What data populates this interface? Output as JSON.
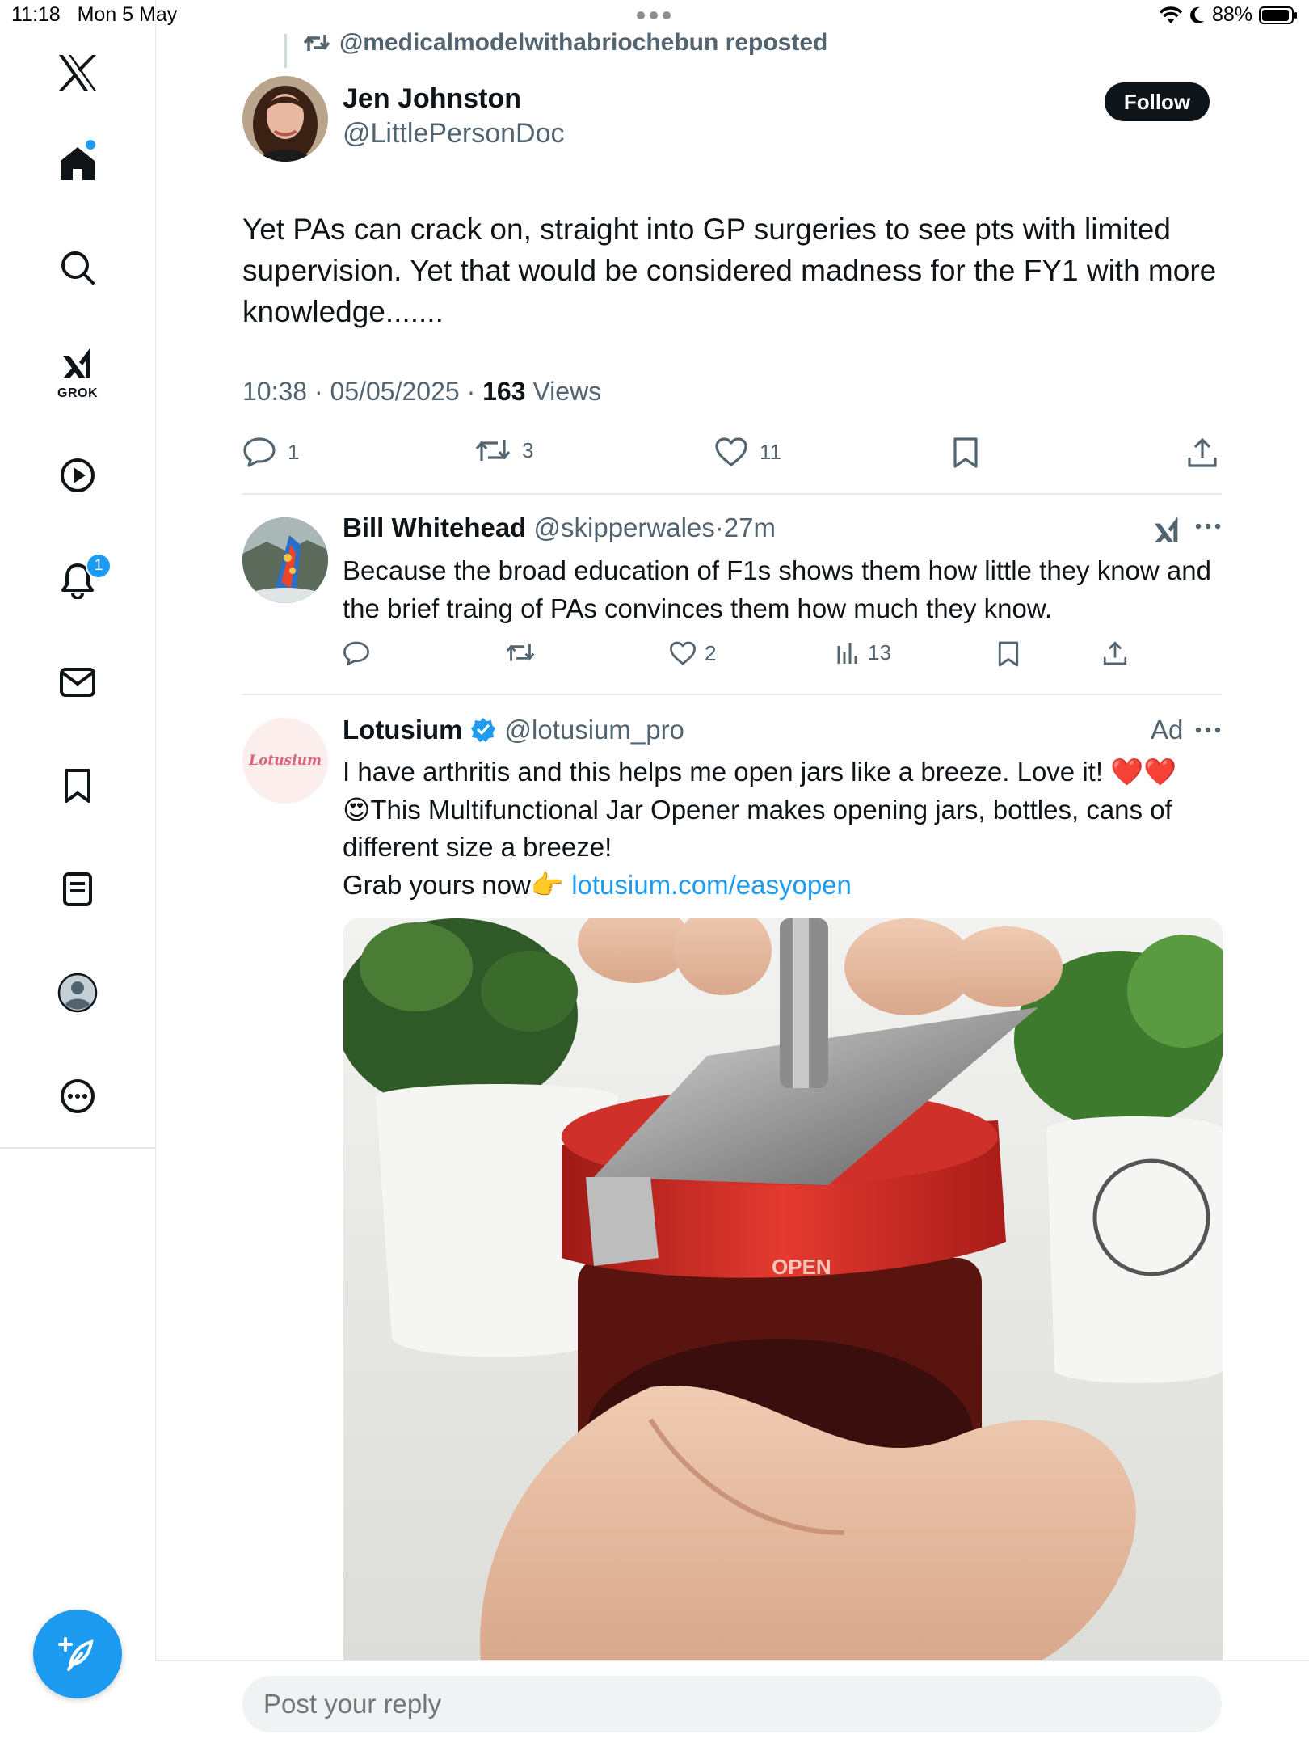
{
  "status_bar": {
    "time": "11:18",
    "date": "Mon 5 May",
    "battery": "88%"
  },
  "sidebar": {
    "grok_label": "GROK",
    "notification_count": "1",
    "accent_color": "#1d9bf0"
  },
  "repost": {
    "text": "@medicalmodelwithabriochebun reposted"
  },
  "post": {
    "author_name": "Jen Johnston",
    "author_handle": "@LittlePersonDoc",
    "follow_label": "Follow",
    "text": "Yet PAs can crack on, straight into GP surgeries to see pts with limited supervision. Yet that would be considered madness for the FY1 with more knowledge.......",
    "time": "10:38",
    "date": "05/05/2025",
    "views_count": "163",
    "views_label": "Views",
    "reply_count": "1",
    "repost_count": "3",
    "like_count": "11"
  },
  "reply": {
    "author_name": "Bill Whitehead",
    "author_handle": "@skipperwales",
    "age": "27m",
    "text": "Because the broad education of F1s shows them how little they know and the brief traing of PAs convinces them how much they know.",
    "like_count": "2",
    "views_count": "13"
  },
  "ad": {
    "author_name": "Lotusium",
    "author_handle": "@lotusium_pro",
    "avatar_text": "Lotusium",
    "ad_label": "Ad",
    "line1": "I have arthritis and this helps me open jars like a breeze. Love it! ❤️❤️",
    "line2": "😍This Multifunctional Jar Opener makes opening jars, bottles, cans of different size a breeze!",
    "line3_prefix": "Grab yours now👉 ",
    "link": "lotusium.com/easyopen",
    "media_text": "OPEN"
  },
  "reply_box": {
    "placeholder": "Post your reply"
  }
}
